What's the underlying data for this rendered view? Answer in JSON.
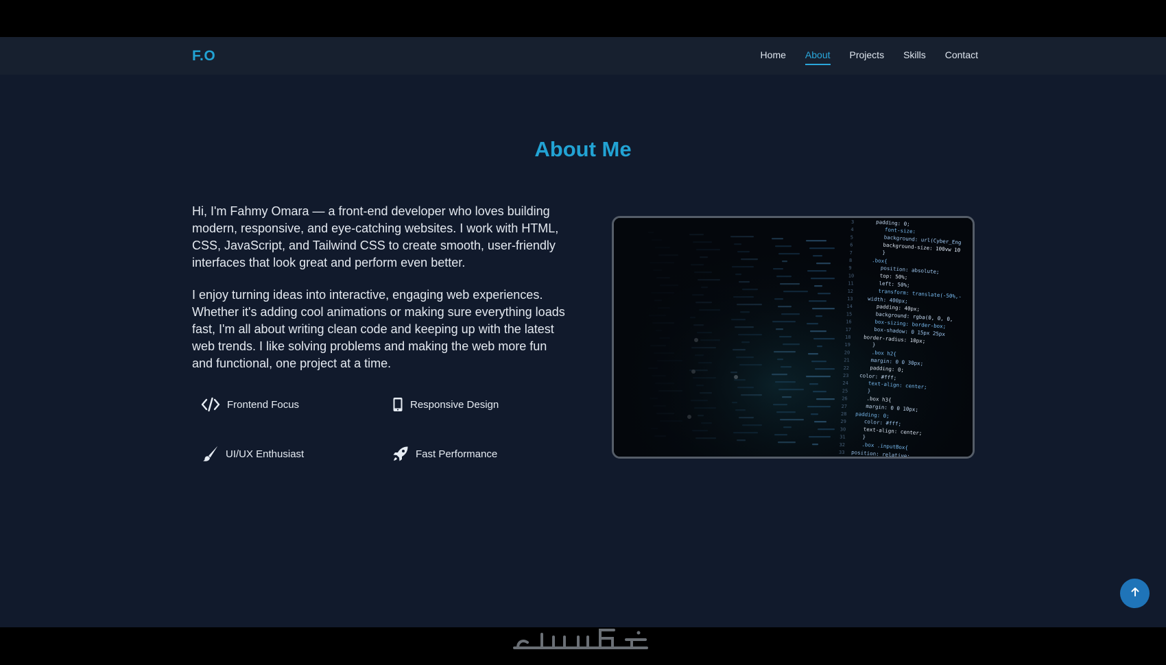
{
  "brand": {
    "logo": "F.O"
  },
  "nav": {
    "items": [
      {
        "label": "Home",
        "active": false
      },
      {
        "label": "About",
        "active": true
      },
      {
        "label": "Projects",
        "active": false
      },
      {
        "label": "Skills",
        "active": false
      },
      {
        "label": "Contact",
        "active": false
      }
    ]
  },
  "about": {
    "title": "About Me",
    "paragraph_1": "Hi, I'm Fahmy Omara — a front-end developer who loves building modern, responsive, and eye-catching websites. I work with HTML, CSS, JavaScript, and Tailwind CSS to create smooth, user-friendly interfaces that look great and perform even better.",
    "paragraph_2": "I enjoy turning ideas into interactive, engaging web experiences. Whether it's adding cool animations or making sure everything loads fast, I'm all about writing clean code and keeping up with the latest web trends. I like solving problems and making the web more fun and functional, one project at a time.",
    "features": [
      {
        "label": "Frontend Focus",
        "icon": "code-icon"
      },
      {
        "label": "Responsive Design",
        "icon": "mobile-icon"
      },
      {
        "label": "UI/UX Enthusiast",
        "icon": "paintbrush-icon"
      },
      {
        "label": "Fast Performance",
        "icon": "rocket-icon"
      }
    ]
  },
  "image": {
    "icon": "code-screen-image",
    "code_lines": [
      "padding: 0;",
      "font-size:",
      "background: url(Cyber_Eng",
      "background-size: 100vw 10",
      "}",
      ".box{",
      "position: absolute;",
      "top: 50%;",
      "left: 50%;",
      "transform: translate(-50%,-",
      "width: 400px;",
      "padding: 40px;",
      "background: rgba(0, 0, 0,",
      "box-sizing: border-box;",
      "box-shadow: 0 15px 25px",
      "border-radius: 10px;",
      "}",
      ".box h2{",
      "margin: 0 0 30px;",
      "padding: 0;",
      "color: #fff;",
      "text-align: center;",
      "}",
      ".box h3{",
      "margin: 0 0 10px;",
      "padding: 0;",
      "color: #fff;",
      "text-align: center;",
      "}",
      ".box .inputBox{",
      "position: relative;"
    ]
  },
  "scroll_top": {
    "icon": "arrow-up-icon"
  },
  "watermark": {
    "text": "خمسات"
  },
  "colors": {
    "accent": "#22a3d4",
    "background": "#111a2c",
    "navbar": "#17202f",
    "button": "#1f74b8"
  }
}
